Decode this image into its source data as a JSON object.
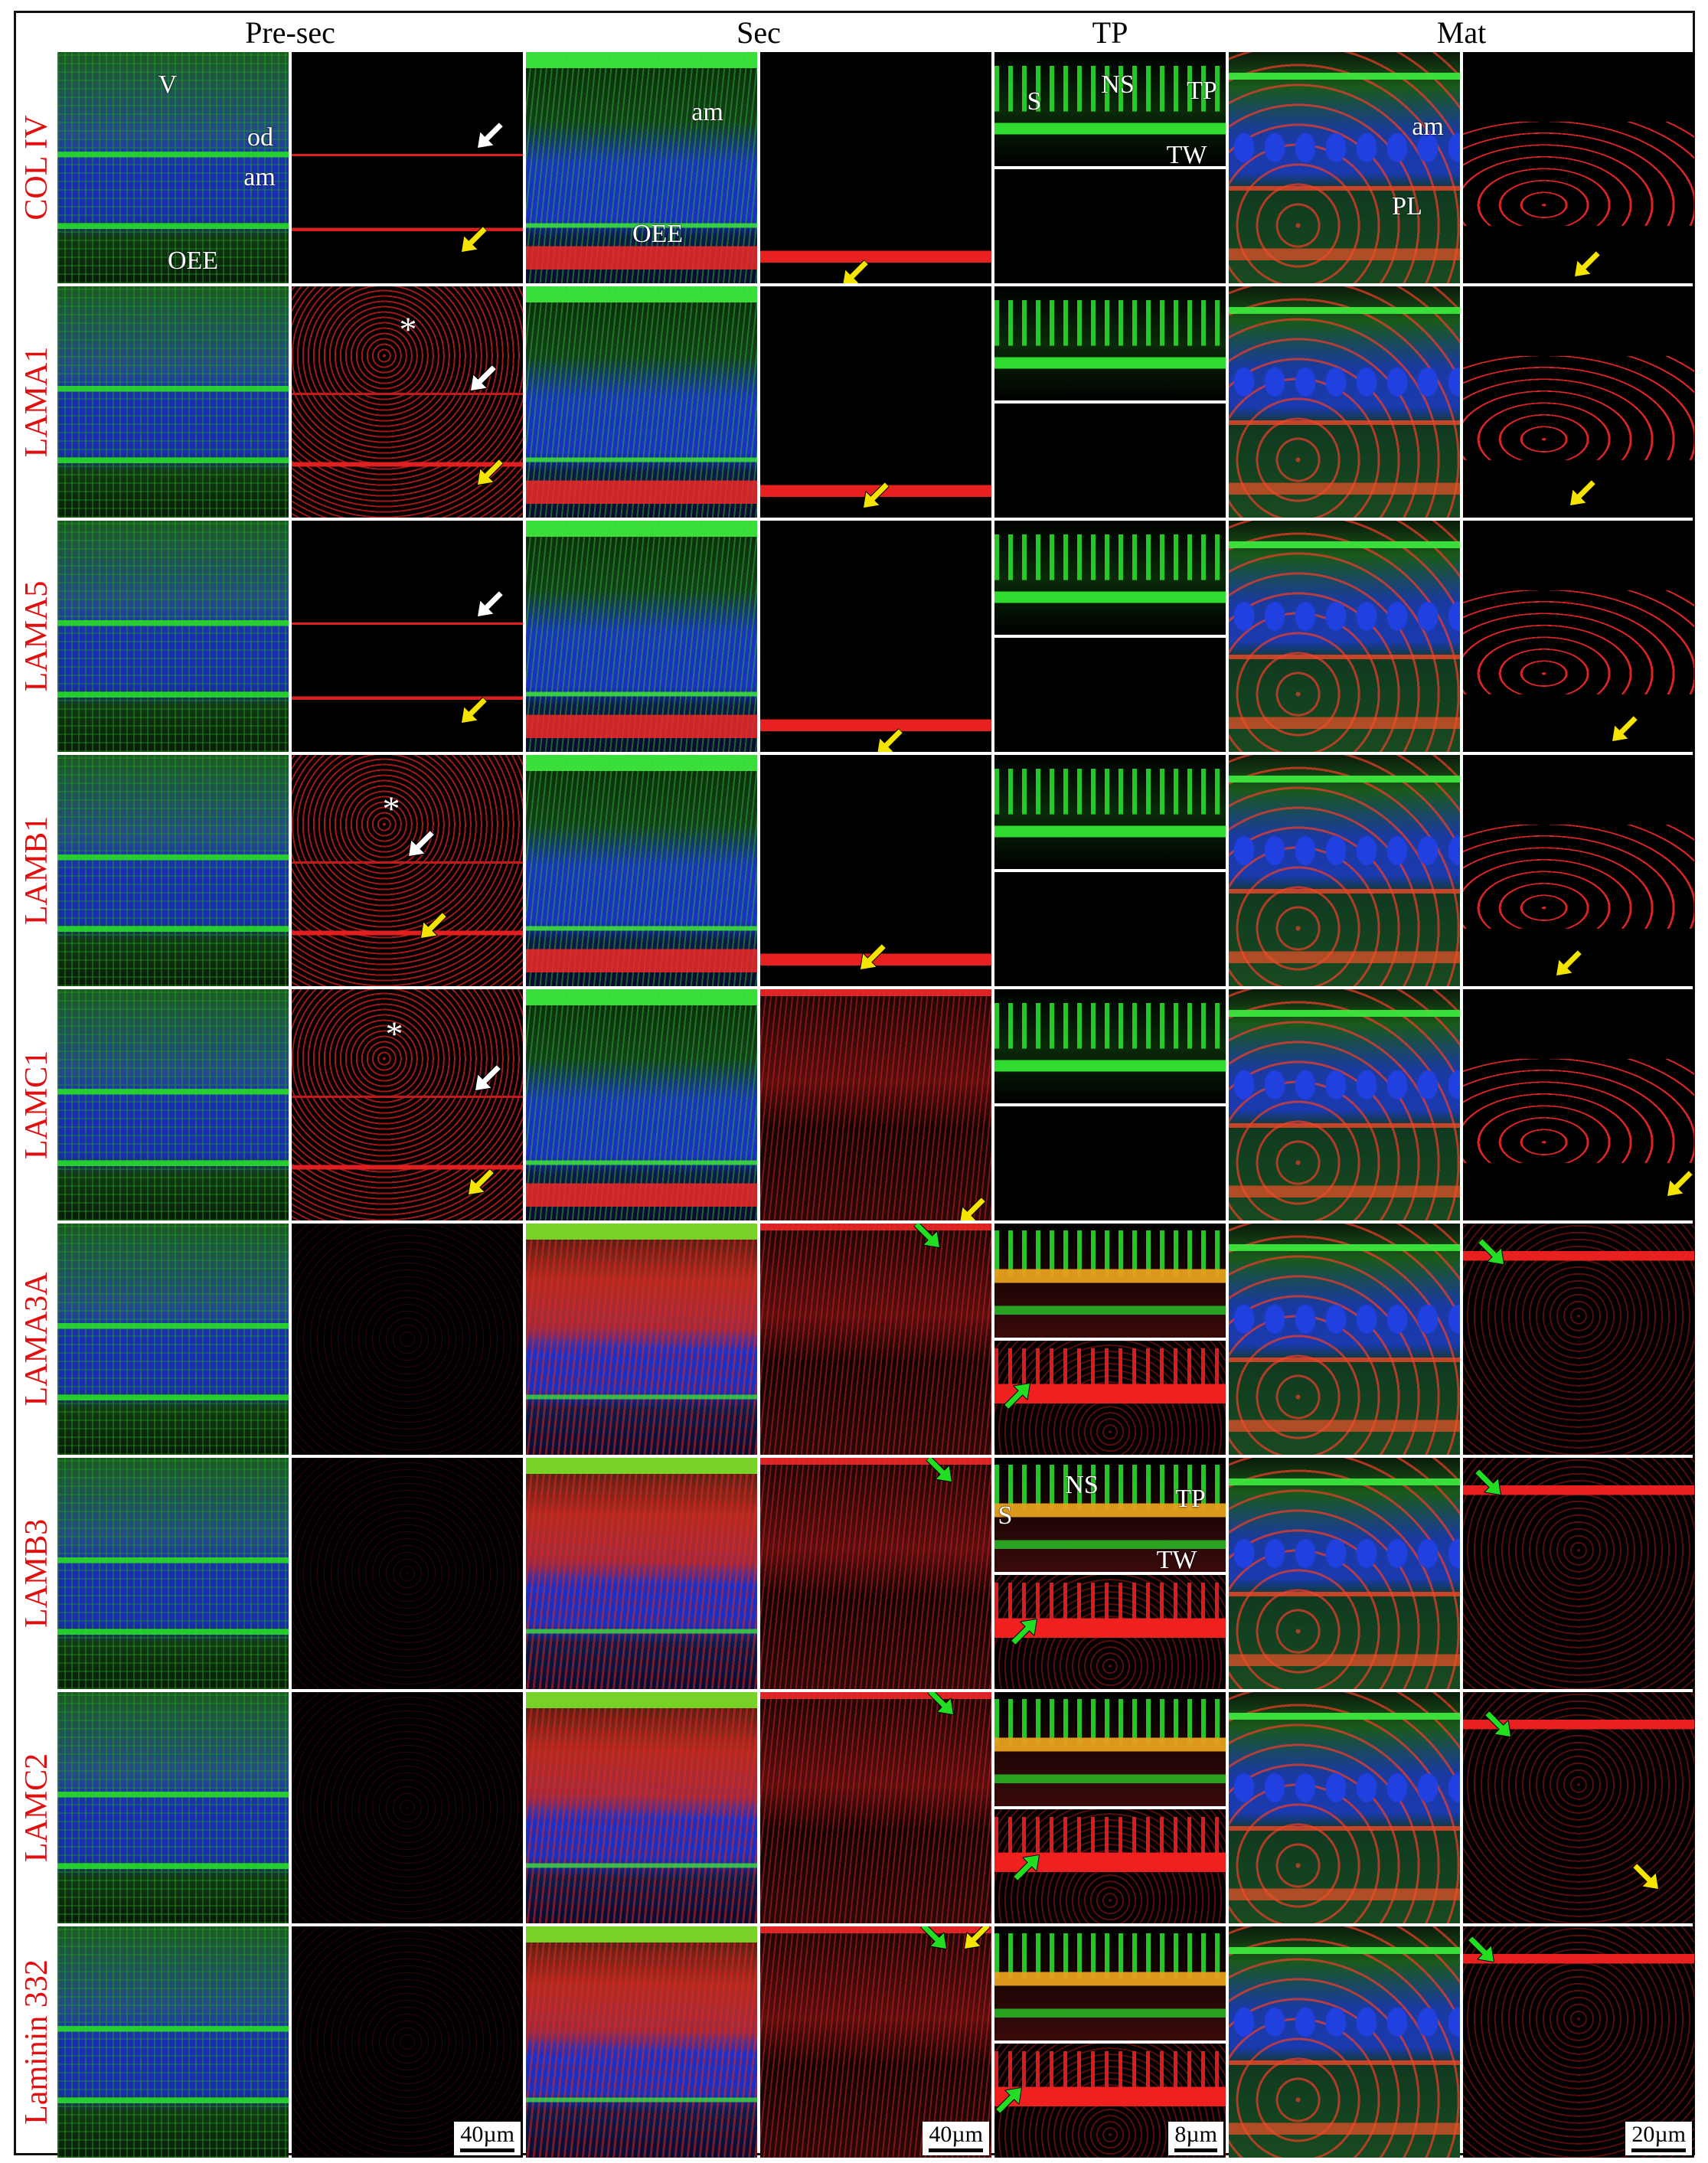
{
  "header": {
    "pre_sec": "Pre-sec",
    "sec": "Sec",
    "tp": "TP",
    "mat": "Mat"
  },
  "rows": [
    {
      "label": "COL IV"
    },
    {
      "label": "LAMA1"
    },
    {
      "label": "LAMA5"
    },
    {
      "label": "LAMB1"
    },
    {
      "label": "LAMC1"
    },
    {
      "label": "LAMA3A"
    },
    {
      "label": "LAMB3"
    },
    {
      "label": "LAMC2"
    },
    {
      "label": "Laminin 332"
    }
  ],
  "annotations": {
    "r0c0": [
      "V",
      "od",
      "am",
      "OEE"
    ],
    "r0c2": [
      "am",
      "OEE"
    ],
    "r0c4": [
      "S",
      "NS",
      "TP",
      "TW"
    ],
    "r0c5": [
      "am",
      "PL"
    ],
    "r1c1": [
      "*"
    ],
    "r3c1": [
      "*"
    ],
    "r4c1": [
      "*"
    ],
    "r6c4": [
      "S",
      "NS",
      "TP",
      "TW"
    ]
  },
  "scale_bars": {
    "presec": "40µm",
    "sec": "40µm",
    "tp": "8µm",
    "mat": "20µm"
  },
  "colors": {
    "label_red": "#e01010",
    "arrow_white": "#ffffff",
    "arrow_yellow": "#f5e400",
    "arrow_green": "#22dd22"
  }
}
